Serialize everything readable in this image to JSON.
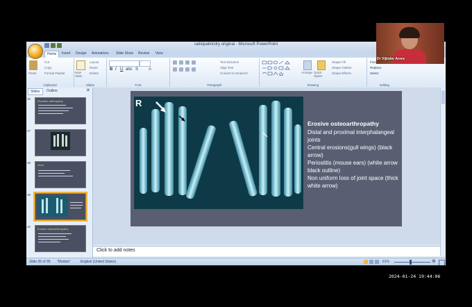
{
  "window": {
    "title": "radiopalmistry original - Microsoft PowerPoint"
  },
  "ribbon_tabs": [
    "Home",
    "Insert",
    "Design",
    "Animations",
    "Slide Show",
    "Review",
    "View"
  ],
  "ribbon": {
    "clipboard": {
      "label": "Clipboard",
      "paste": "Paste",
      "cut": "Cut",
      "copy": "Copy",
      "format_painter": "Format Painter"
    },
    "slides": {
      "label": "Slides",
      "new_slide": "New Slide",
      "layout": "Layout",
      "reset": "Reset",
      "delete": "Delete"
    },
    "font": {
      "label": "Font"
    },
    "paragraph": {
      "label": "Paragraph",
      "text_direction": "Text Direction",
      "align_text": "Align Text",
      "convert": "Convert to SmartArt"
    },
    "drawing": {
      "label": "Drawing",
      "arrange": "Arrange",
      "quick_styles": "Quick Styles",
      "shape_fill": "Shape Fill",
      "shape_outline": "Shape Outline",
      "shape_effects": "Shape Effects"
    },
    "editing": {
      "label": "Editing",
      "find": "Find",
      "replace": "Replace",
      "select": "Select"
    }
  },
  "panel_tabs": {
    "slides": "Slides",
    "outline": "Outline"
  },
  "thumbnails": [
    {
      "num": "36",
      "title": "Psoriatic arthropathy"
    },
    {
      "num": "37",
      "title": ""
    },
    {
      "num": "38",
      "title": "Gout"
    },
    {
      "num": "39",
      "title": ""
    },
    {
      "num": "40",
      "title": "Erosive osteoarthropathy"
    }
  ],
  "slide": {
    "xray_label": "R",
    "heading": "Erosive osteoarthropathy",
    "lines": [
      "Distal and proximal interphalangeal joints",
      "Central erosions(gull wings) (black arrow)",
      "Periostitis (mouse ears) (white arrow black outline)",
      "Non uniform loss of joint space (thick white arrow)"
    ]
  },
  "notes": {
    "placeholder": "Click to add notes"
  },
  "status": {
    "slide_info": "Slide 39 of 99",
    "theme": "\"Module\"",
    "language": "English (United States)",
    "zoom": "61%"
  },
  "webcam": {
    "name": "Dr Vijinder Arora"
  },
  "timestamp": "2024-01-24  19:44:06"
}
